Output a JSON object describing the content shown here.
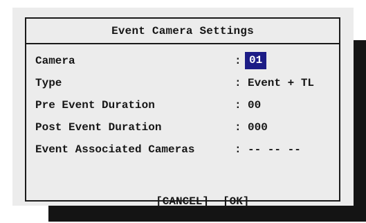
{
  "dialog": {
    "title": "Event Camera Settings"
  },
  "fields": {
    "camera": {
      "label": "Camera",
      "colon": ":",
      "value": "01"
    },
    "type": {
      "label": "Type",
      "colon": ":",
      "value": "Event + TL"
    },
    "pre_event_duration": {
      "label": "Pre Event Duration",
      "colon": ":",
      "value": "00"
    },
    "post_event_duration": {
      "label": "Post Event Duration",
      "colon": ":",
      "value": "000"
    },
    "event_associated_cameras": {
      "label": "Event Associated Cameras",
      "colon": ":",
      "value": "-- -- --"
    }
  },
  "buttons": {
    "cancel_label": "[CANCEL]",
    "ok_label": "[OK]"
  },
  "colors": {
    "panel_background": "#ececec",
    "border": "#1a1a1a",
    "shadow": "#141414",
    "highlight_background": "#1c1c86",
    "highlight_text": "#ffffff",
    "text": "#161616"
  }
}
